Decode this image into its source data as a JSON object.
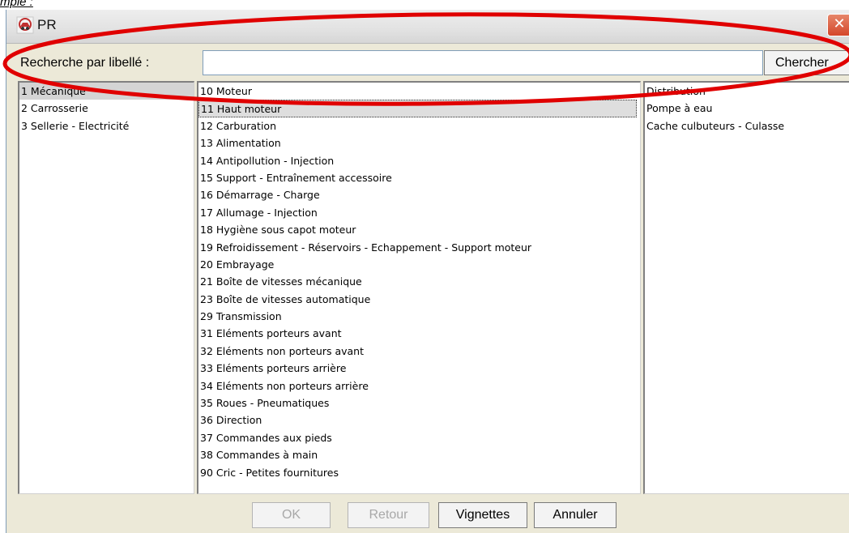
{
  "doc_caption": "mple :",
  "window": {
    "title": "PR",
    "close_symbol": "✕"
  },
  "search": {
    "label": "Recherche par libellé :",
    "value": "",
    "placeholder": "",
    "button_label": "Chercher"
  },
  "categories": [
    {
      "label": "1 Mécanique",
      "selected": true
    },
    {
      "label": "2 Carrosserie"
    },
    {
      "label": "3 Sellerie - Electricité"
    }
  ],
  "subcategories": [
    {
      "label": "10 Moteur"
    },
    {
      "label": "11 Haut moteur",
      "selected": true
    },
    {
      "label": "12 Carburation"
    },
    {
      "label": "13 Alimentation"
    },
    {
      "label": "14 Antipollution - Injection"
    },
    {
      "label": "15 Support - Entraînement accessoire"
    },
    {
      "label": "16 Démarrage - Charge"
    },
    {
      "label": "17 Allumage - Injection"
    },
    {
      "label": "18 Hygiène sous capot moteur"
    },
    {
      "label": "19 Refroidissement - Réservoirs - Echappement - Support moteur"
    },
    {
      "label": "20 Embrayage"
    },
    {
      "label": "21 Boîte de vitesses mécanique"
    },
    {
      "label": "23 Boîte de vitesses automatique"
    },
    {
      "label": "29 Transmission"
    },
    {
      "label": "31 Eléments porteurs avant"
    },
    {
      "label": "32 Eléments non porteurs avant"
    },
    {
      "label": "33 Eléments porteurs arrière"
    },
    {
      "label": "34 Eléments non porteurs arrière"
    },
    {
      "label": "35 Roues - Pneumatiques"
    },
    {
      "label": "36 Direction"
    },
    {
      "label": "37 Commandes aux pieds"
    },
    {
      "label": "38 Commandes à main"
    },
    {
      "label": "90 Cric - Petites fournitures"
    }
  ],
  "details": [
    {
      "label": "Distribution"
    },
    {
      "label": "Pompe à eau"
    },
    {
      "label": "Cache culbuteurs - Culasse"
    }
  ],
  "buttons": {
    "ok": {
      "label": "OK",
      "enabled": false
    },
    "retour": {
      "label": "Retour",
      "enabled": false
    },
    "vignettes": {
      "label": "Vignettes",
      "enabled": true
    },
    "annuler": {
      "label": "Annuler",
      "enabled": true
    }
  },
  "colors": {
    "annotation_ellipse": "#e00000",
    "window_bg": "#ece9d8",
    "close_button": "#d4462a"
  },
  "icons": {
    "app": "car-app-icon",
    "close": "close-icon"
  }
}
